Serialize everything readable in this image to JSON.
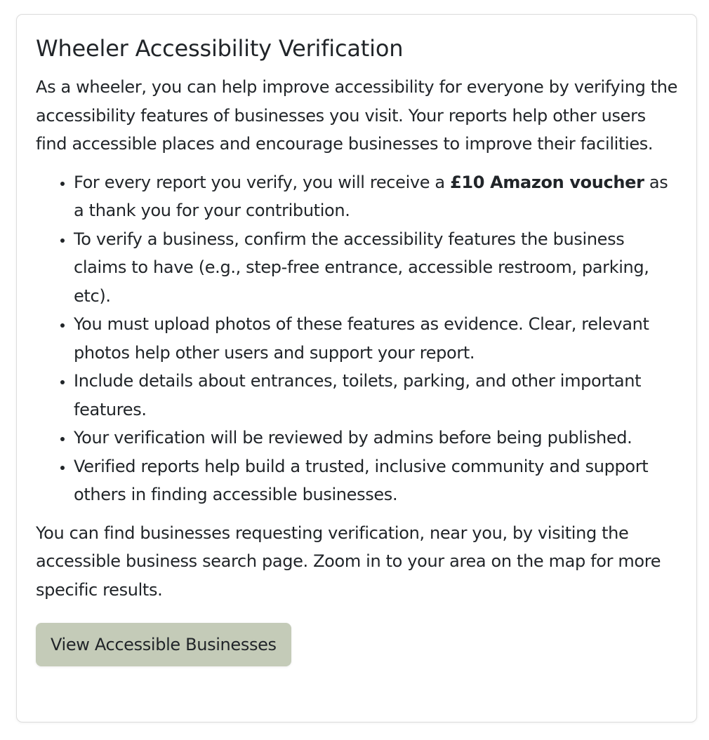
{
  "card": {
    "title": "Wheeler Accessibility Verification",
    "intro": "As a wheeler, you can help improve accessibility for everyone by verifying the accessibility features of businesses you visit. Your reports help other users find accessible places and encourage businesses to improve their facilities.",
    "bullets": [
      {
        "before": "For every report you verify, you will receive a ",
        "bold": "£10 Amazon voucher",
        "after": " as a thank you for your contribution."
      },
      {
        "text": "To verify a business, confirm the accessibility features the business claims to have (e.g., step-free entrance, accessible restroom, parking, etc)."
      },
      {
        "text": "You must upload photos of these features as evidence. Clear, relevant photos help other users and support your report."
      },
      {
        "text": "Include details about entrances, toilets, parking, and other important features."
      },
      {
        "text": "Your verification will be reviewed by admins before being published."
      },
      {
        "text": "Verified reports help build a trusted, inclusive community and support others in finding accessible businesses."
      }
    ],
    "outro": "You can find businesses requesting verification, near you, by visiting the accessible business search page. Zoom in to your area on the map for more specific results.",
    "button_label": "View Accessible Businesses"
  },
  "colors": {
    "button_bg": "#c4cbb8",
    "text": "#212529",
    "border": "#dcdcdc"
  }
}
